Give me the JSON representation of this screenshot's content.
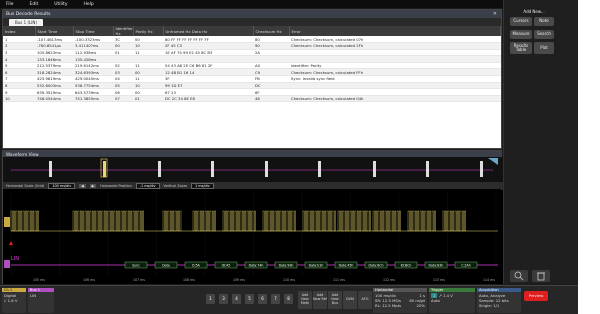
{
  "menu": [
    "File",
    "Edit",
    "Utility",
    "Help"
  ],
  "results_panel": {
    "title": "Bus Decode Results",
    "tab": "Bus 1 (LIN)",
    "columns": [
      "Index",
      "Start Time",
      "Stop Time",
      "Identifier Hx",
      "Parity Hx",
      "Unframed Hx Data Hx",
      "Checksum Hx",
      "Error"
    ],
    "rows": [
      [
        "1",
        "-107.4613ms",
        "-100.3323ms",
        "3C",
        "00",
        "80 FF FF FF FF FF FF FF",
        "80",
        "Checksum: Checksum, calculated 07h"
      ],
      [
        "2",
        "-760.8541µs",
        "3.41140?ms",
        "00",
        "10",
        "2F 45 C3",
        "90",
        "Checksum: Checksum, calculated 2Fh"
      ],
      [
        "3",
        "105.8623ms",
        "112.938ms",
        "01",
        "11",
        "1E AF 74 99 E2 45 8C B3",
        "2A",
        ""
      ],
      [
        "4",
        "133.1646ms",
        "135.428ms",
        "",
        "",
        "",
        "",
        ""
      ],
      [
        "5",
        "212.5379ms",
        "219.6142ms",
        "02",
        "11",
        "54 43 A8 2E C6 B6 81 2F",
        "A0",
        "Identifier: Parity"
      ],
      [
        "6",
        "318.2824ms",
        "324.6393ms",
        "03",
        "00",
        "12 4B B1 16 14",
        "C9",
        "Checksum: Checksum, calculated FFh"
      ],
      [
        "7",
        "425.9819ms",
        "429.0045ms",
        "04",
        "11",
        "3F",
        "FB",
        "Sync: Invalid sync field"
      ],
      [
        "8",
        "532.6003ms",
        "536.7754ms",
        "05",
        "10",
        "99 1D E7",
        "DC",
        ""
      ],
      [
        "9",
        "639.3519ms",
        "643.5739ms",
        "06",
        "00",
        "67 23",
        "6F",
        ""
      ],
      [
        "10",
        "746.0544ms",
        "751.3855ms",
        "07",
        "01",
        "DC 2C 34 8E E8",
        "48",
        "Checksum: Checksum, calculated 04h"
      ]
    ]
  },
  "sidebar": {
    "add_new": "Add New...",
    "cursors": "Cursors",
    "note": "Note",
    "measure": "Measure",
    "search": "Search",
    "results_table": "Results Table",
    "plot": "Plot"
  },
  "waveform": {
    "title": "Waveform View",
    "scale_row": {
      "h_scale_label": "Horizontal Scale (Grid)",
      "h_scale_value": "100 ms/div",
      "h_pos_label": "Horizontal Position",
      "h_pos_value": "-1 ms/div",
      "v_scale_label": "Vertical Zoom",
      "v_scale_value": "1 ms/div"
    },
    "ch_label": "LIN",
    "bus_labels": [
      "Sync",
      "Data",
      "D:5A",
      "ID:A5",
      "Data:74h",
      "Data:99h",
      "Data:E2h",
      "Data:45h",
      "Data:8Ch",
      "ID:BCh",
      "Data:B3h",
      "C:2Ah"
    ],
    "top_ticks": [
      "100 ms",
      "200 ms",
      "300 ms",
      "400 ms",
      "500 ms",
      "600 ms",
      "700 ms"
    ],
    "bottom_ticks": [
      "105 ms",
      "106 ms",
      "107 ms",
      "108 ms",
      "109 ms",
      "110 ms",
      "111 ms",
      "112 ms",
      "113 ms",
      "114 ms"
    ]
  },
  "bottom": {
    "ch1": {
      "name": "Ch 1",
      "lines": [
        "Digital",
        "√ 1.6 V"
      ]
    },
    "bus1": {
      "name": "Bus 1",
      "lines": [
        "LIN"
      ]
    },
    "channels": [
      "1",
      "3",
      "4",
      "5",
      "6",
      "7",
      "8"
    ],
    "add_buttons": [
      "Add New Math",
      "Add New Ref",
      "Add New Bus"
    ],
    "dvm": "DVM",
    "afg": "AFG",
    "horizontal": {
      "title": "Horizontal",
      "lines": [
        "100 ms/div",
        "SR: 12.5 MS/s",
        "RL: 12.5 Mpts",
        "1 s",
        "80 ns/pt",
        "20%"
      ]
    },
    "trigger": {
      "title": "Trigger",
      "lines": [
        "1",
        "1.4 V",
        "Auto"
      ]
    },
    "acquisition": {
      "title": "Acquisition",
      "lines": [
        "Auto,",
        "Analyze",
        "Sample: 12 bits",
        "Single: 1/1"
      ]
    },
    "preview": "Preview"
  },
  "colors": {
    "accent_pink": "#e040e0",
    "digital_yellow": "#e8d86a",
    "bus_green": "#8ad48a",
    "preview_red": "#e02020"
  }
}
